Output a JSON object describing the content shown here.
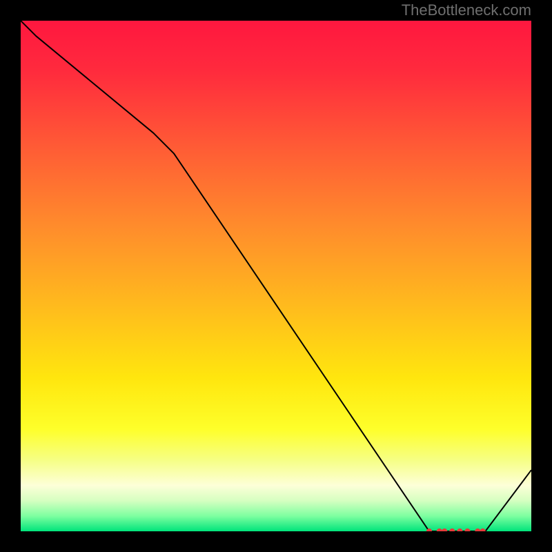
{
  "watermark": "TheBottleneck.com",
  "chart_data": {
    "type": "line",
    "title": "",
    "xlabel": "",
    "ylabel": "",
    "xlim": [
      0,
      100
    ],
    "ylim": [
      0,
      100
    ],
    "series": [
      {
        "name": "curve",
        "x": [
          0,
          3,
          26,
          30,
          80,
          82,
          90,
          91,
          100
        ],
        "values": [
          100,
          97,
          78,
          74,
          0,
          0,
          0,
          0,
          12
        ]
      }
    ],
    "dots": {
      "name": "flat-region-markers",
      "x": [
        80,
        82,
        83,
        84.5,
        86,
        87.5,
        89.5,
        90.5
      ],
      "values": [
        0,
        0,
        0,
        0,
        0,
        0,
        0,
        0
      ]
    },
    "gradient_stops": [
      {
        "pos": 0.0,
        "color": "#ff173f"
      },
      {
        "pos": 0.1,
        "color": "#ff2b3d"
      },
      {
        "pos": 0.25,
        "color": "#ff5c35"
      },
      {
        "pos": 0.4,
        "color": "#ff8b2c"
      },
      {
        "pos": 0.55,
        "color": "#ffb81e"
      },
      {
        "pos": 0.7,
        "color": "#ffe60e"
      },
      {
        "pos": 0.8,
        "color": "#feff2a"
      },
      {
        "pos": 0.86,
        "color": "#f6ff84"
      },
      {
        "pos": 0.91,
        "color": "#fdffd8"
      },
      {
        "pos": 0.94,
        "color": "#d6ffc1"
      },
      {
        "pos": 0.97,
        "color": "#7effa0"
      },
      {
        "pos": 1.0,
        "color": "#00e47b"
      }
    ]
  }
}
